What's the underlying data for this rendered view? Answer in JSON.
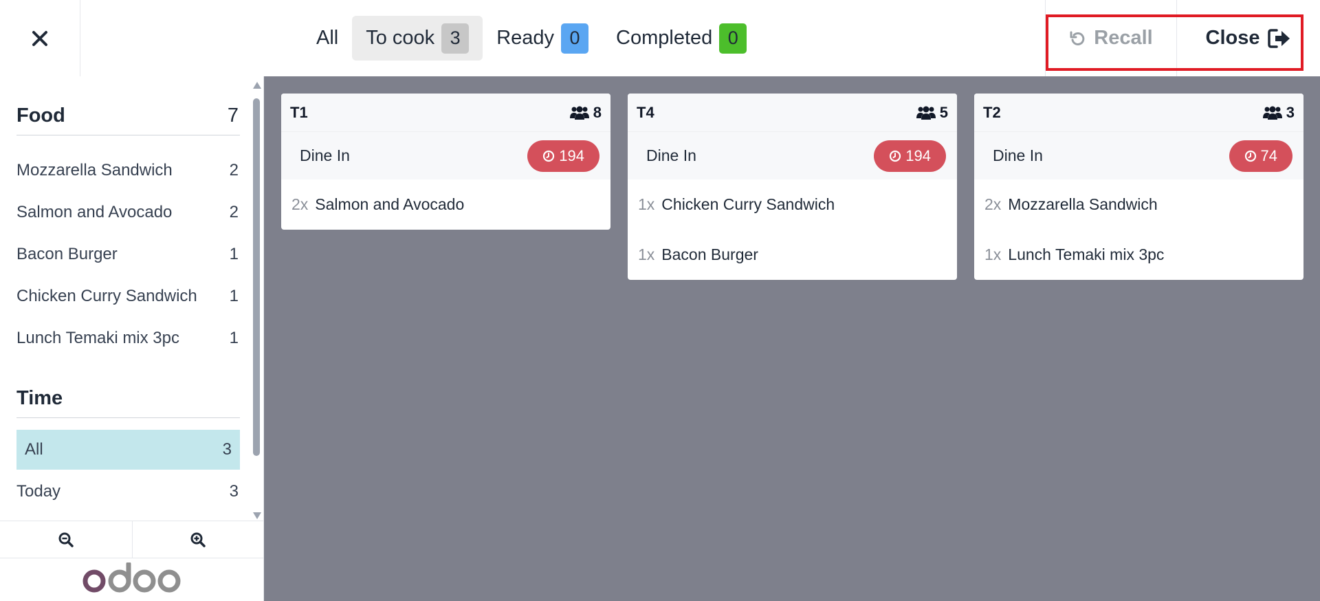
{
  "topbar": {
    "tabs": [
      {
        "label": "All",
        "count": ""
      },
      {
        "label": "To cook",
        "count": "3"
      },
      {
        "label": "Ready",
        "count": "0"
      },
      {
        "label": "Completed",
        "count": "0"
      }
    ],
    "recall_label": "Recall",
    "close_label": "Close"
  },
  "sidebar": {
    "food": {
      "title": "Food",
      "count": "7",
      "items": [
        {
          "label": "Mozzarella Sandwich",
          "count": "2"
        },
        {
          "label": "Salmon and Avocado",
          "count": "2"
        },
        {
          "label": "Bacon Burger",
          "count": "1"
        },
        {
          "label": "Chicken Curry Sandwich",
          "count": "1"
        },
        {
          "label": "Lunch Temaki mix 3pc",
          "count": "1"
        }
      ]
    },
    "time": {
      "title": "Time",
      "items": [
        {
          "label": "All",
          "count": "3"
        },
        {
          "label": "Today",
          "count": "3"
        }
      ]
    },
    "logo_text": "odoo"
  },
  "orders": [
    {
      "table": "T1",
      "guests": "8",
      "type": "Dine In",
      "timer": "194",
      "lines": [
        {
          "qty": "2x",
          "name": "Salmon and Avocado"
        }
      ]
    },
    {
      "table": "T4",
      "guests": "5",
      "type": "Dine In",
      "timer": "194",
      "lines": [
        {
          "qty": "1x",
          "name": "Chicken Curry Sandwich"
        },
        {
          "qty": "1x",
          "name": "Bacon Burger"
        }
      ]
    },
    {
      "table": "T2",
      "guests": "3",
      "type": "Dine In",
      "timer": "74",
      "lines": [
        {
          "qty": "2x",
          "name": "Mozzarella Sandwich"
        },
        {
          "qty": "1x",
          "name": "Lunch Temaki mix 3pc"
        }
      ]
    }
  ],
  "colors": {
    "highlight": "#e01b24",
    "timer_badge": "#d4505b",
    "main_bg": "#7e808c",
    "selected_item": "#c3e7ec",
    "ready_badge": "#5aa6f2",
    "completed_badge": "#4cbe2b"
  }
}
